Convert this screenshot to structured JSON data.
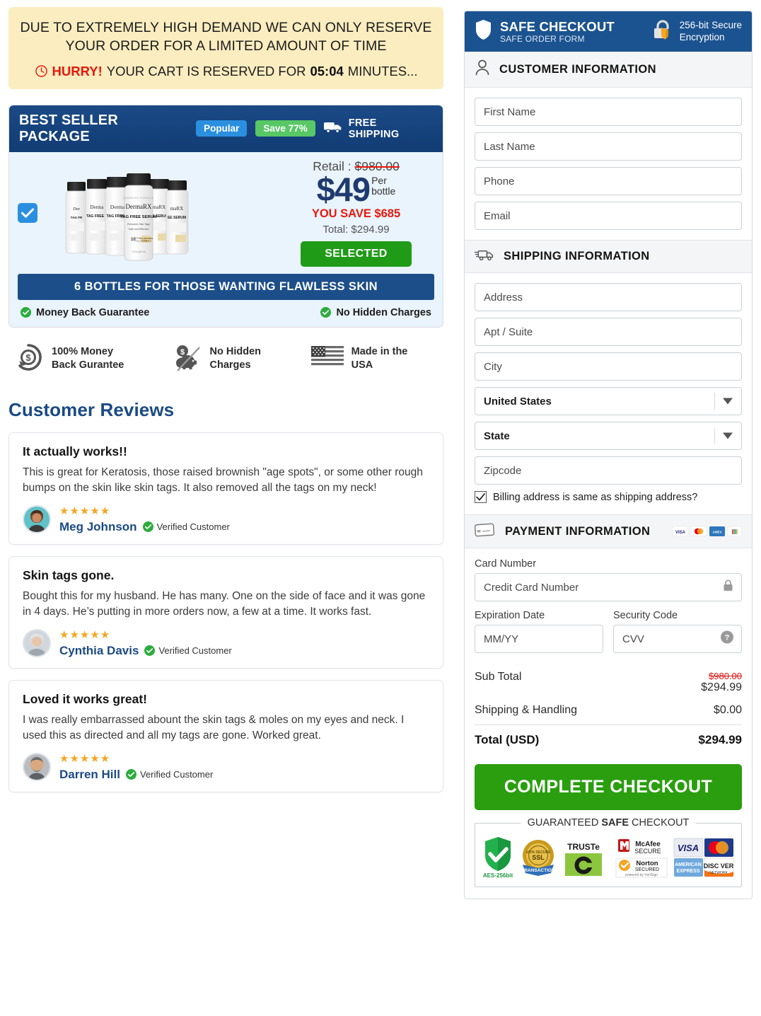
{
  "urgency": {
    "line1": "DUE TO EXTREMELY HIGH DEMAND WE CAN ONLY RESERVE YOUR ORDER FOR A LIMITED AMOUNT OF TIME",
    "hurry_label": "HURRY!",
    "reserved_text": "YOUR CART IS RESERVED FOR",
    "timer": "05:04",
    "minutes_text": "MINUTES...",
    "clock_icon": "clock-icon",
    "bg_color": "#fbedc0",
    "hurry_color": "#e8180c"
  },
  "package": {
    "title": "BEST SELLER PACKAGE",
    "badge_popular": "Popular",
    "badge_save": "Save 77%",
    "badge_popular_color": "#2b8fe0",
    "badge_save_color": "#58c765",
    "free_shipping": "FREE SHIPPING",
    "truck_icon": "truck-icon",
    "checkbox_icon": "checkmark-icon",
    "selected": true,
    "product_name": "DermaRX",
    "product_subtitle": "TAG FREE SERUM",
    "retail_label": "Retail :",
    "retail_price": "$980.00",
    "price_amount": "$49",
    "price_per": "Per",
    "price_per2": "bottle",
    "you_save": "YOU SAVE $685",
    "total_line": "Total: $294.99",
    "select_button": "SELECTED",
    "subtitle_bar": "6 BOTTLES FOR THOSE WANTING FLAWLESS SKIN",
    "foot_left": "Money Back Guarantee",
    "foot_right": "No Hidden Charges",
    "price_color": "#1f3a6e",
    "header_color": "#123c74"
  },
  "guarantees": [
    {
      "icon": "money-back-icon",
      "line1": "100% Money",
      "line2": "Back Gurantee"
    },
    {
      "icon": "piggy-bank-no-fees-icon",
      "line1": "No Hidden",
      "line2": "Charges"
    },
    {
      "icon": "usa-flag-icon",
      "line1": "Made in the",
      "line2": "USA"
    }
  ],
  "reviews": {
    "heading": "Customer Reviews",
    "verified_label": "Verified Customer",
    "stars": "★★★★★",
    "items": [
      {
        "title": "It actually works!!",
        "body": "This is great for Keratosis, those raised brownish \"age spots\", or some other rough bumps on the skin like skin tags. It also removed all the tags on my neck!",
        "name": "Meg Johnson",
        "avatar": "woman-avatar-1"
      },
      {
        "title": "Skin tags gone.",
        "body": "Bought this for my husband. He has many. One on the side of face and it was gone in 4 days. He’s putting in more orders now, a few at a time. It works fast.",
        "name": "Cynthia Davis",
        "avatar": "woman-avatar-2"
      },
      {
        "title": "Loved it works great!",
        "body": "I was really embarrassed abount the skin tags & moles on my eyes and neck. I used this as directed and all my tags are gone. Worked great.",
        "name": "Darren Hill",
        "avatar": "man-avatar-1"
      }
    ]
  },
  "checkout": {
    "header": {
      "title": "SAFE CHECKOUT",
      "subtitle": "SAFE ORDER FORM",
      "shield_icon": "shield-icon",
      "lock_icon": "padlock-icon",
      "encryption_bits": "256-bit",
      "encryption_word": "Secure",
      "encryption_line2": "Encryption",
      "bg_color": "#1b5390"
    },
    "customer": {
      "section_title": "CUSTOMER INFORMATION",
      "icon": "person-icon",
      "first_name_placeholder": "First Name",
      "last_name_placeholder": "Last Name",
      "phone_placeholder": "Phone",
      "email_placeholder": "Email"
    },
    "shipping": {
      "section_title": "SHIPPING INFORMATION",
      "icon": "truck-icon",
      "address_placeholder": "Address",
      "apt_placeholder": "Apt / Suite",
      "city_placeholder": "City",
      "country_value": "United States",
      "state_value": "State",
      "zipcode_placeholder": "Zipcode",
      "billing_same_label": "Billing address is same as shipping address?",
      "billing_same_checked": true
    },
    "payment": {
      "section_title": "PAYMENT INFORMATION",
      "icon": "credit-card-icon",
      "accepted_cards": [
        "visa",
        "mastercard",
        "amex",
        "other"
      ],
      "card_number_label": "Card Number",
      "card_number_placeholder": "Credit Card Number",
      "card_lock_icon": "lock-icon",
      "expiration_label": "Expiration Date",
      "expiration_placeholder": "MM/YY",
      "security_label": "Security Code",
      "security_placeholder": "CVV",
      "security_help_icon": "question-icon"
    },
    "totals": {
      "sub_total_label": "Sub Total",
      "sub_total_strike": "$980.00",
      "sub_total_value": "$294.99",
      "shipping_label": "Shipping & Handling",
      "shipping_value": "$0.00",
      "grand_label": "Total (USD)",
      "grand_value": "$294.99"
    },
    "cta_label": "COMPLETE CHECKOUT",
    "cta_color": "#2a9e0f",
    "seal": {
      "caption_pre": "GUARANTEED ",
      "caption_bold": "SAFE",
      "caption_post": " CHECKOUT",
      "badges": [
        "aes-256bit-shield",
        "ssl-transaction",
        "truste",
        "mcafee-secure",
        "norton-secured",
        "visa",
        "mastercard",
        "amex",
        "discover"
      ],
      "aes_label": "AES-256bit"
    }
  }
}
